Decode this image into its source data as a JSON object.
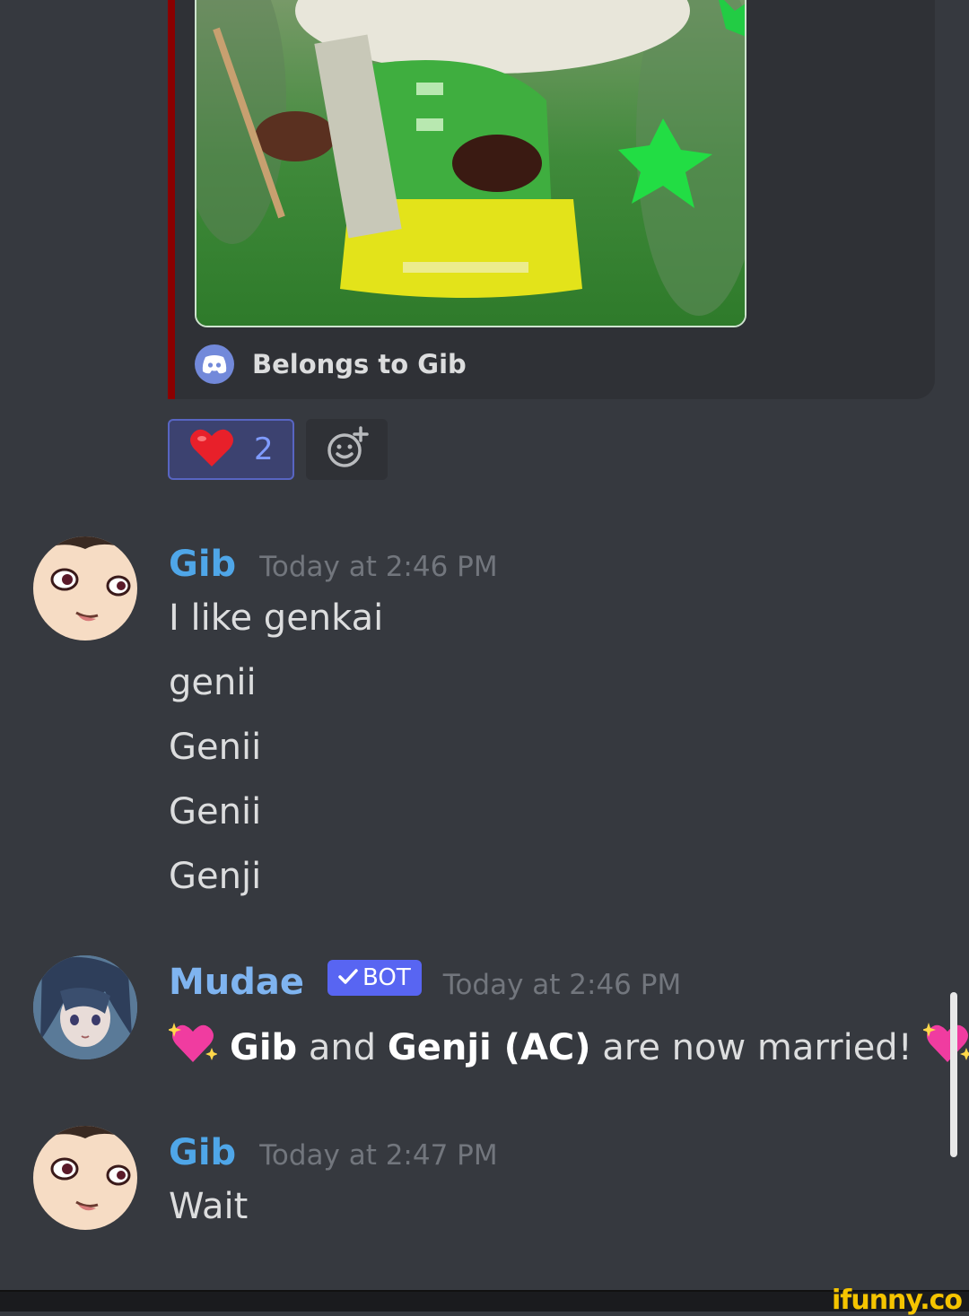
{
  "embed": {
    "footer_text": "Belongs to Gib",
    "border_color": "#8b0000"
  },
  "reaction": {
    "emoji": "heart-icon",
    "count": "2"
  },
  "messages": [
    {
      "username": "Gib",
      "timestamp": "Today at 2:46 PM",
      "lines": [
        "I like genkai",
        "genii",
        "Genii",
        "Genii",
        "Genji"
      ]
    },
    {
      "username": "Mudae",
      "bot_tag": "BOT",
      "timestamp": "Today at 2:46 PM",
      "text_parts": [
        "Gib",
        " and ",
        "Genji (AC)",
        " are now married! "
      ]
    },
    {
      "username": "Gib",
      "timestamp": "Today at 2:47 PM",
      "lines": [
        "Wait"
      ]
    }
  ],
  "watermark": "ifunny.co"
}
